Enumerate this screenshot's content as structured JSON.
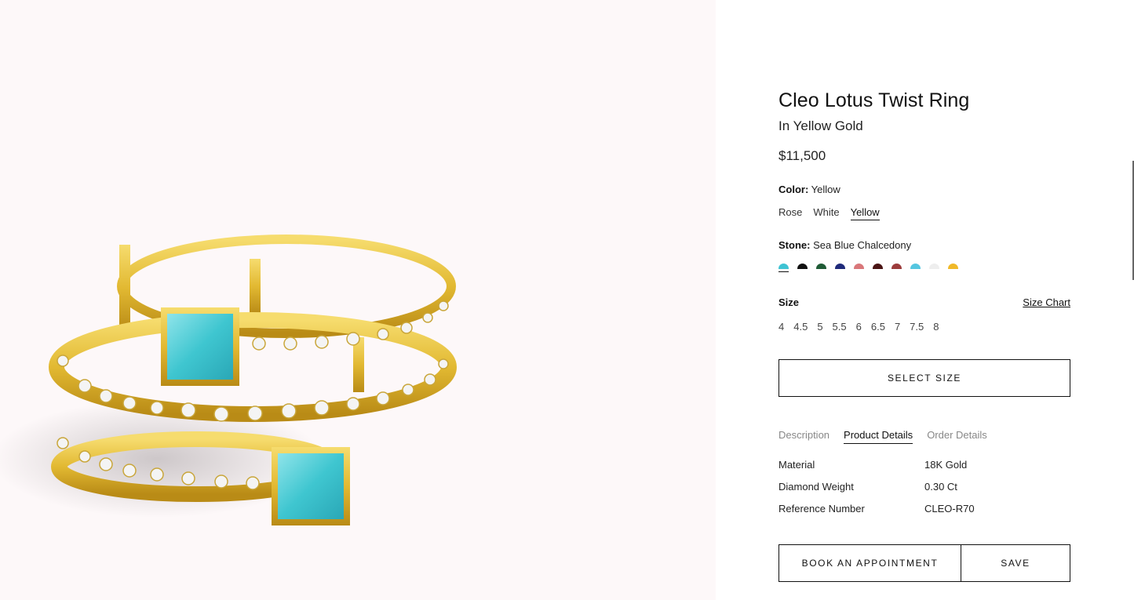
{
  "product": {
    "title": "Cleo Lotus Twist Ring",
    "subtitle": "In Yellow Gold",
    "price": "$11,500"
  },
  "color": {
    "label": "Color:",
    "value": "Yellow",
    "options": [
      "Rose",
      "White",
      "Yellow"
    ],
    "selected": "Yellow"
  },
  "stone": {
    "label": "Stone:",
    "value": "Sea Blue Chalcedony",
    "swatch_colors": [
      "#3ec3d3",
      "#111111",
      "#1f5b36",
      "#1f2a7a",
      "#d9777a",
      "#4a1414",
      "#9c3c3c",
      "#55c6e0",
      "#eeeeee",
      "#f0b929"
    ]
  },
  "size": {
    "label": "Size",
    "chart_link": "Size Chart",
    "options": [
      "4",
      "4.5",
      "5",
      "5.5",
      "6",
      "6.5",
      "7",
      "7.5",
      "8"
    ]
  },
  "buttons": {
    "select_size": "SELECT SIZE",
    "book": "BOOK AN APPOINTMENT",
    "save": "SAVE"
  },
  "tabs": [
    "Description",
    "Product Details",
    "Order Details"
  ],
  "active_tab": "Product Details",
  "details": [
    {
      "key": "Material",
      "value": "18K Gold"
    },
    {
      "key": "Diamond Weight",
      "value": "0.30 Ct"
    },
    {
      "key": "Reference Number",
      "value": "CLEO-R70"
    }
  ],
  "colors": {
    "image_bg": "#fdf8f9",
    "gold": "#e6c040",
    "turquoise": "#3fc6d0"
  }
}
